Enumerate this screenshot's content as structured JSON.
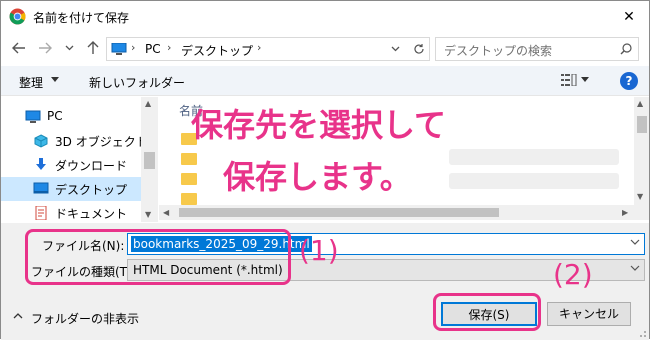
{
  "window": {
    "title": "名前を付けて保存",
    "close_label": "✕"
  },
  "address": {
    "crumbs": [
      "PC",
      "デスクトップ"
    ],
    "search_placeholder": "デスクトップの検索"
  },
  "toolbar": {
    "organize": "整理",
    "new_folder": "新しいフォルダー",
    "help": "?"
  },
  "nav_pane": {
    "items": [
      {
        "label": "PC",
        "icon": "pc-icon"
      },
      {
        "label": "3D オブジェクト",
        "icon": "3d-objects-icon"
      },
      {
        "label": "ダウンロード",
        "icon": "download-icon"
      },
      {
        "label": "デスクトップ",
        "icon": "desktop-icon",
        "selected": true
      },
      {
        "label": "ドキュメント",
        "icon": "document-icon"
      }
    ]
  },
  "file_list": {
    "column_name": "名前"
  },
  "form": {
    "filename_label": "ファイル名(N):",
    "filename_value": "bookmarks_2025_09_29.html",
    "filetype_label": "ファイルの種類(T):",
    "filetype_value": "HTML Document (*.html)",
    "hide_folders": "フォルダーの非表示",
    "save_button": "保存(S)",
    "cancel_button": "キャンセル"
  },
  "annotation": {
    "line1": "保存先を選択して",
    "line2": "保存します。",
    "marker1": "(1)",
    "marker2": "(2)",
    "color": "#e8338a"
  },
  "colors": {
    "accent": "#0078d7",
    "selection": "#cce8ff",
    "help": "#1967d2"
  }
}
